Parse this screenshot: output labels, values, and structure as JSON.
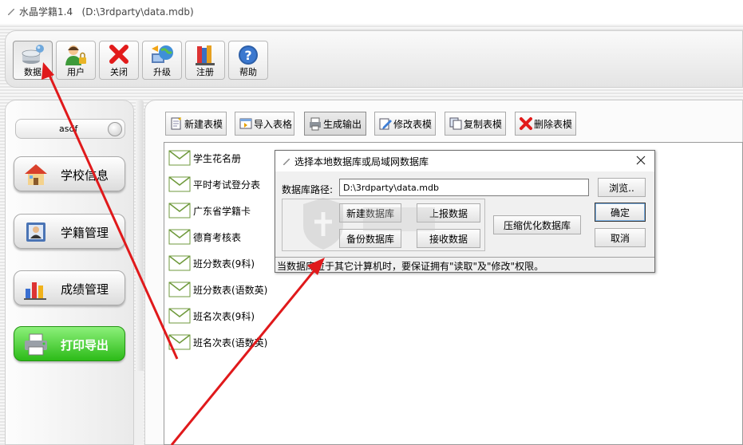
{
  "window": {
    "title": "水晶学籍1.4   (D:\\3rdparty\\data.mdb)"
  },
  "toolbar": {
    "buttons": [
      {
        "label": "数据",
        "icon": "database-icon"
      },
      {
        "label": "用户",
        "icon": "user-lock-icon"
      },
      {
        "label": "关闭",
        "icon": "close-x-icon"
      },
      {
        "label": "升级",
        "icon": "globe-upgrade-icon"
      },
      {
        "label": "注册",
        "icon": "books-register-icon"
      },
      {
        "label": "帮助",
        "icon": "help-icon"
      }
    ]
  },
  "sidebar": {
    "user": "asdf",
    "nav": [
      {
        "label": "学校信息",
        "icon": "school-house-icon"
      },
      {
        "label": "学籍管理",
        "icon": "student-card-icon"
      },
      {
        "label": "成绩管理",
        "icon": "bar-chart-icon"
      },
      {
        "label": "打印导出",
        "icon": "printer-icon"
      }
    ]
  },
  "actions": [
    {
      "label": "新建表模",
      "icon": "new-template-icon"
    },
    {
      "label": "导入表格",
      "icon": "import-table-icon"
    },
    {
      "label": "生成输出",
      "icon": "generate-output-icon"
    },
    {
      "label": "修改表模",
      "icon": "edit-template-icon"
    },
    {
      "label": "复制表模",
      "icon": "copy-template-icon"
    },
    {
      "label": "删除表模",
      "icon": "delete-template-icon"
    }
  ],
  "templates": [
    "学生花名册",
    "平时考试登分表",
    "广东省学籍卡",
    "德育考核表",
    "班分数表(9科)",
    "班分数表(语数英)",
    "班名次表(9科)",
    "班名次表(语数英)"
  ],
  "dialog": {
    "title": "选择本地数据库或局域网数据库",
    "path_label": "数据库路径:",
    "path_value": "D:\\3rdparty\\data.mdb",
    "browse": "浏览..",
    "new_db": "新建数据库",
    "upload": "上报数据",
    "backup": "备份数据库",
    "receive": "接收数据",
    "compress": "压缩优化数据库",
    "ok": "确定",
    "cancel": "取消",
    "status": "当数据库位于其它计算机时，要保证拥有\"读取\"及\"修改\"权限。"
  },
  "colors": {
    "annotation_arrow": "#e0191b",
    "active_nav": "#2cbb18"
  }
}
